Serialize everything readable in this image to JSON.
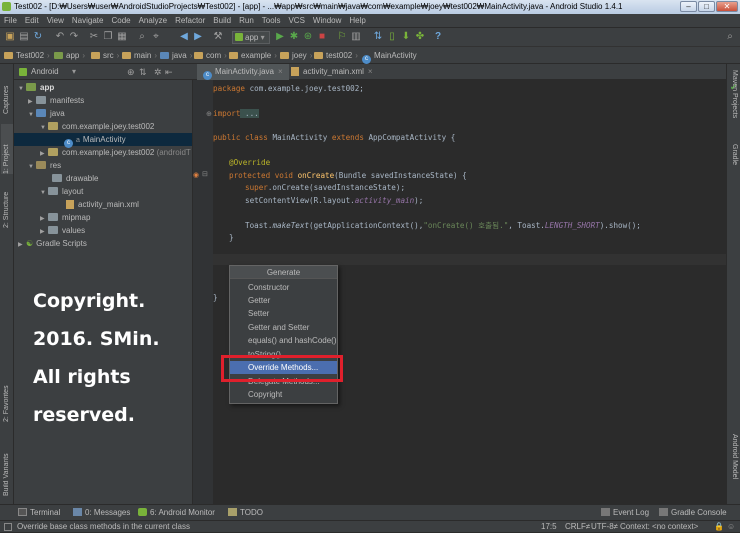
{
  "window": {
    "title": "Test002 - [D:₩Users₩user₩AndroidStudioProjects₩Test002] - [app] - ...₩app₩src₩main₩java₩com₩example₩joey₩test002₩MainActivity.java - Android Studio 1.4.1",
    "minimize": "–",
    "maximize": "□",
    "close": "✕"
  },
  "menu": [
    "File",
    "Edit",
    "View",
    "Navigate",
    "Code",
    "Analyze",
    "Refactor",
    "Build",
    "Run",
    "Tools",
    "VCS",
    "Window",
    "Help"
  ],
  "toolbar": {
    "run_config": "app",
    "help": "?"
  },
  "breadcrumbs": [
    "Test002",
    "app",
    "src",
    "main",
    "java",
    "com",
    "example",
    "joey",
    "test002",
    "MainActivity"
  ],
  "left_tool_tabs": [
    "Captures",
    "1: Project",
    "2: Structure",
    "2: Favorites",
    "Build Variants"
  ],
  "right_tool_tabs": [
    "Maven Projects",
    "Gradle",
    "Android Model"
  ],
  "project_panel": {
    "view": "Android",
    "tree": [
      {
        "label": "app",
        "level": 0,
        "icon": "app"
      },
      {
        "label": "manifests",
        "level": 1,
        "icon": "folder"
      },
      {
        "label": "java",
        "level": 1,
        "icon": "java"
      },
      {
        "label": "com.example.joey.test002",
        "level": 2,
        "icon": "package"
      },
      {
        "label": "MainActivity",
        "level": 3,
        "icon": "class",
        "selected": true
      },
      {
        "label": "com.example.joey.test002",
        "suffix": " (androidT",
        "level": 2,
        "icon": "package"
      },
      {
        "label": "res",
        "level": 1,
        "icon": "res"
      },
      {
        "label": "drawable",
        "level": 2,
        "icon": "folder"
      },
      {
        "label": "layout",
        "level": 2,
        "icon": "folder"
      },
      {
        "label": "activity_main.xml",
        "level": 3,
        "icon": "file"
      },
      {
        "label": "mipmap",
        "level": 2,
        "icon": "folder"
      },
      {
        "label": "values",
        "level": 2,
        "icon": "folder"
      },
      {
        "label": "Gradle Scripts",
        "level": 0,
        "icon": "gradle"
      }
    ]
  },
  "editor_tabs": [
    {
      "label": "MainActivity.java",
      "active": true
    },
    {
      "label": "activity_main.xml",
      "active": false
    }
  ],
  "code": {
    "package_kw": "package",
    "package_name": " com.example.joey.test002;",
    "import_kw": "import",
    "import_fold": " ...",
    "class_line": [
      "public class",
      " MainActivity ",
      "extends",
      " AppCompatActivity {"
    ],
    "override": "@Override",
    "method_line": [
      "protected void",
      " onCreate",
      "(Bundle savedInstanceState) {"
    ],
    "super_line": [
      "super",
      ".onCreate(savedInstanceState);"
    ],
    "setcontent_line": [
      "setContentView(R.layout.",
      "activity_main",
      ");"
    ],
    "toast_line": [
      "Toast.",
      "makeText",
      "(getApplicationContext(),",
      "\"onCreate() 호출됨.\"",
      ", Toast.",
      "LENGTH_SHORT",
      ").show();"
    ],
    "close_method": "}",
    "close_class": "}"
  },
  "watermark": [
    "Copyright.",
    "2016. SMin.",
    "All rights",
    "reserved."
  ],
  "generate_popup": {
    "title": "Generate",
    "items": [
      "Constructor",
      "Getter",
      "Setter",
      "Getter and Setter",
      "equals() and hashCode()",
      "toString()",
      "Override Methods...",
      "Delegate Methods...",
      "Copyright"
    ],
    "selected_index": 6
  },
  "bottom_tools": {
    "left": [
      "Terminal",
      "0: Messages",
      "6: Android Monitor",
      "TODO"
    ],
    "right": [
      "Event Log",
      "Gradle Console"
    ]
  },
  "status": {
    "message": "Override base class methods in the current class",
    "position": "17:5",
    "line_sep": "CRLF≠",
    "encoding": "UTF-8≠",
    "context": "Context: <no context>"
  },
  "colors": {
    "highlight_box": "#e0202c",
    "selection": "#4b6eaf"
  }
}
